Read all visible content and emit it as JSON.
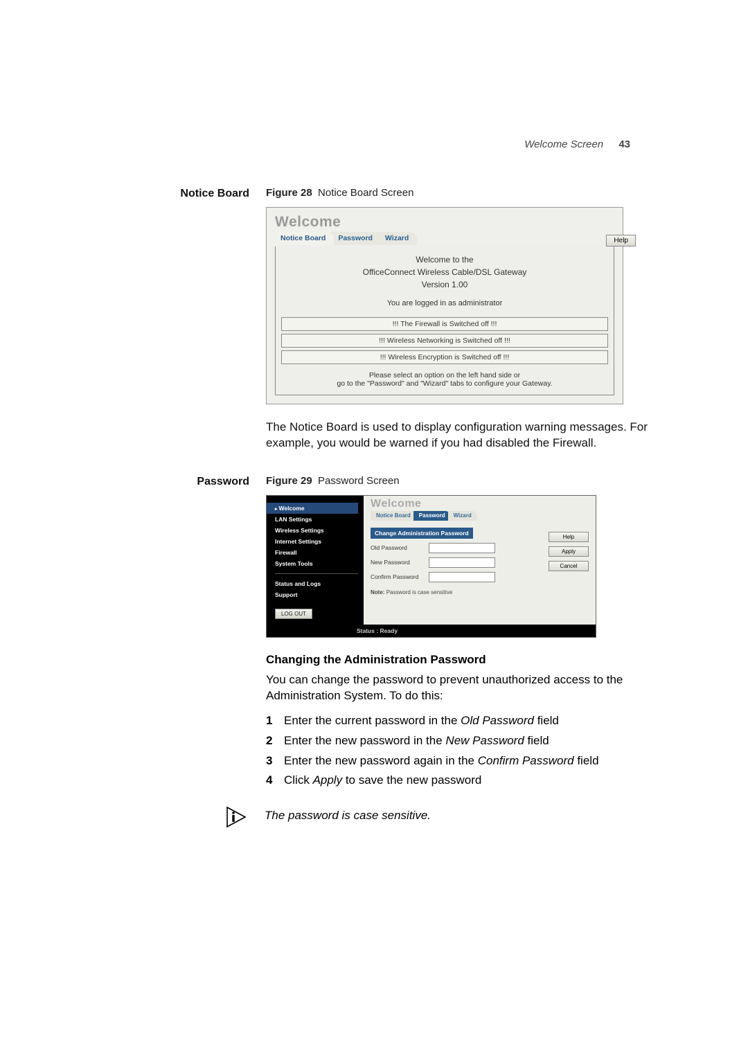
{
  "header": {
    "section": "Welcome Screen",
    "page": "43"
  },
  "notice": {
    "label": "Notice Board",
    "figLabel": "Figure 28",
    "figTitle": "Notice Board Screen",
    "welcome": "Welcome",
    "tabs": [
      "Notice Board",
      "Password",
      "Wizard"
    ],
    "line1": "Welcome to the",
    "line2": "OfficeConnect Wireless Cable/DSL Gateway",
    "line3": "Version 1.00",
    "logged": "You are logged in as administrator",
    "bars": [
      "!!! The Firewall is Switched off !!!",
      "!!! Wireless Networking is Switched off !!!",
      "!!! Wireless Encryption is Switched off !!!"
    ],
    "foot1": "Please select an option on the left hand side or",
    "foot2": "go to the \"Password\" and \"Wizard\" tabs to configure your Gateway.",
    "help": "Help",
    "para": "The Notice Board is used to display configuration warning messages. For example, you would be warned if you had disabled the Firewall."
  },
  "password": {
    "label": "Password",
    "figLabel": "Figure 29",
    "figTitle": "Password Screen",
    "sidebar": [
      "Welcome",
      "LAN Settings",
      "Wireless Settings",
      "Internet Settings",
      "Firewall",
      "System Tools"
    ],
    "sidebar2": [
      "Status and Logs",
      "Support"
    ],
    "logout": "LOG OUT",
    "welcome": "Welcome",
    "tabs": [
      "Notice Board",
      "Password",
      "Wizard"
    ],
    "panelHead": "Change Administration Password",
    "oldLabel": "Old Password",
    "newLabel": "New Password",
    "confirmLabel": "Confirm Password",
    "note": "Password is case sensitive",
    "noteLabel": "Note:",
    "help": "Help",
    "apply": "Apply",
    "cancel": "Cancel",
    "status": "Status : Ready",
    "h3": "Changing the Administration Password",
    "intro": "You can change the password to prevent unauthorized access to the Administration System. To do this:",
    "steps": {
      "s1a": "Enter the current password in the ",
      "s1b": "Old Password",
      "s1c": " field",
      "s2a": "Enter the new password in the ",
      "s2b": "New Password",
      "s2c": " field",
      "s3a": "Enter the new password again in the ",
      "s3b": "Confirm Password",
      "s3c": " field",
      "s4a": "Click ",
      "s4b": "Apply",
      "s4c": " to save the new password"
    },
    "footnote": "The password is case sensitive."
  }
}
